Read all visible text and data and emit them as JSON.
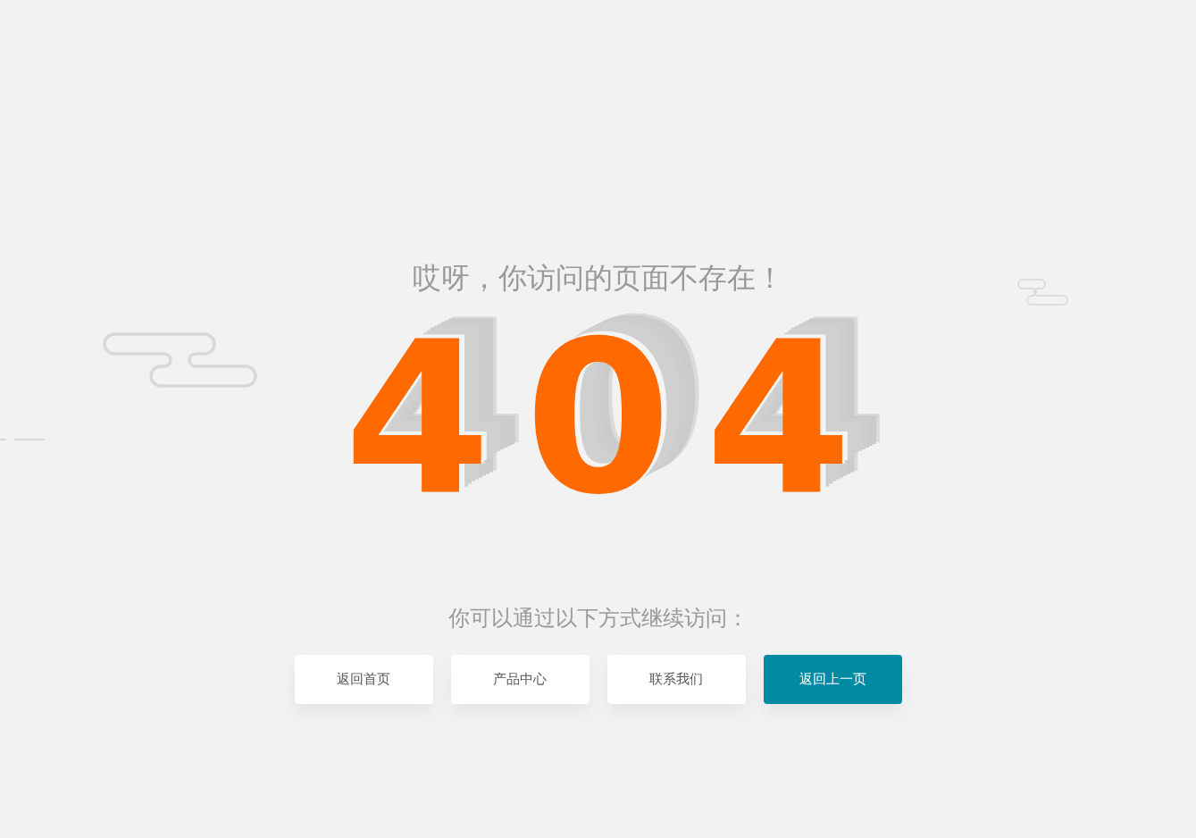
{
  "heading": "哎呀，你访问的页面不存在！",
  "error_code": "404",
  "subheading": "你可以通过以下方式继续访问：",
  "buttons": [
    {
      "label": "返回首页",
      "kind": "default"
    },
    {
      "label": "产品中心",
      "kind": "default"
    },
    {
      "label": "联系我们",
      "kind": "default"
    },
    {
      "label": "返回上一页",
      "kind": "primary"
    }
  ]
}
